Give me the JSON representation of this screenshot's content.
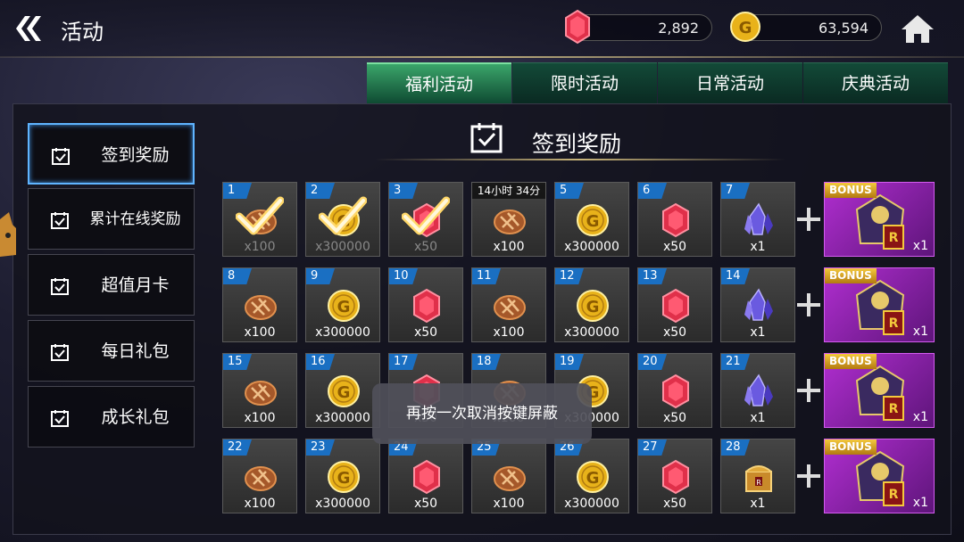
{
  "header": {
    "title": "活动",
    "gems": "2,892",
    "gold": "63,594"
  },
  "tabs": [
    "福利活动",
    "限时活动",
    "日常活动",
    "庆典活动"
  ],
  "sidebar": [
    "签到奖励",
    "累计在线奖励",
    "超值月卡",
    "每日礼包",
    "成长礼包"
  ],
  "section_title": "签到奖励",
  "toast": "再按一次取消按键屏蔽",
  "grid": [
    [
      {
        "day": "1",
        "item": "bread",
        "qty": "x100",
        "claimed": true
      },
      {
        "day": "2",
        "item": "gold",
        "qty": "x300000",
        "claimed": true
      },
      {
        "day": "3",
        "item": "gem",
        "qty": "x50",
        "claimed": true
      },
      {
        "day": "14小时 34分",
        "item": "bread",
        "qty": "x100",
        "timer": true
      },
      {
        "day": "5",
        "item": "gold",
        "qty": "x300000"
      },
      {
        "day": "6",
        "item": "gem",
        "qty": "x50"
      },
      {
        "day": "7",
        "item": "crystal",
        "qty": "x1"
      }
    ],
    [
      {
        "day": "8",
        "item": "bread",
        "qty": "x100"
      },
      {
        "day": "9",
        "item": "gold",
        "qty": "x300000"
      },
      {
        "day": "10",
        "item": "gem",
        "qty": "x50"
      },
      {
        "day": "11",
        "item": "bread",
        "qty": "x100"
      },
      {
        "day": "12",
        "item": "gold",
        "qty": "x300000"
      },
      {
        "day": "13",
        "item": "gem",
        "qty": "x50"
      },
      {
        "day": "14",
        "item": "crystal",
        "qty": "x1"
      }
    ],
    [
      {
        "day": "15",
        "item": "bread",
        "qty": "x100"
      },
      {
        "day": "16",
        "item": "gold",
        "qty": "x300000"
      },
      {
        "day": "17",
        "item": "gem",
        "qty": "x50"
      },
      {
        "day": "18",
        "item": "bread",
        "qty": "x100"
      },
      {
        "day": "19",
        "item": "gold",
        "qty": "x300000"
      },
      {
        "day": "20",
        "item": "gem",
        "qty": "x50"
      },
      {
        "day": "21",
        "item": "crystal",
        "qty": "x1"
      }
    ],
    [
      {
        "day": "22",
        "item": "bread",
        "qty": "x100"
      },
      {
        "day": "23",
        "item": "gold",
        "qty": "x300000"
      },
      {
        "day": "24",
        "item": "gem",
        "qty": "x50"
      },
      {
        "day": "25",
        "item": "bread",
        "qty": "x100"
      },
      {
        "day": "26",
        "item": "gold",
        "qty": "x300000"
      },
      {
        "day": "27",
        "item": "gem",
        "qty": "x50"
      },
      {
        "day": "28",
        "item": "chest",
        "qty": "x1"
      }
    ]
  ],
  "bonus": [
    {
      "tag": "BONUS",
      "qty": "x1"
    },
    {
      "tag": "BONUS",
      "qty": "x1"
    },
    {
      "tag": "BONUS",
      "qty": "x1"
    },
    {
      "tag": "BONUS",
      "qty": "x1"
    }
  ],
  "colors": {
    "accent": "#3aa56a",
    "day_badge": "#1a6fc2",
    "bonus": "#b02ed0"
  }
}
